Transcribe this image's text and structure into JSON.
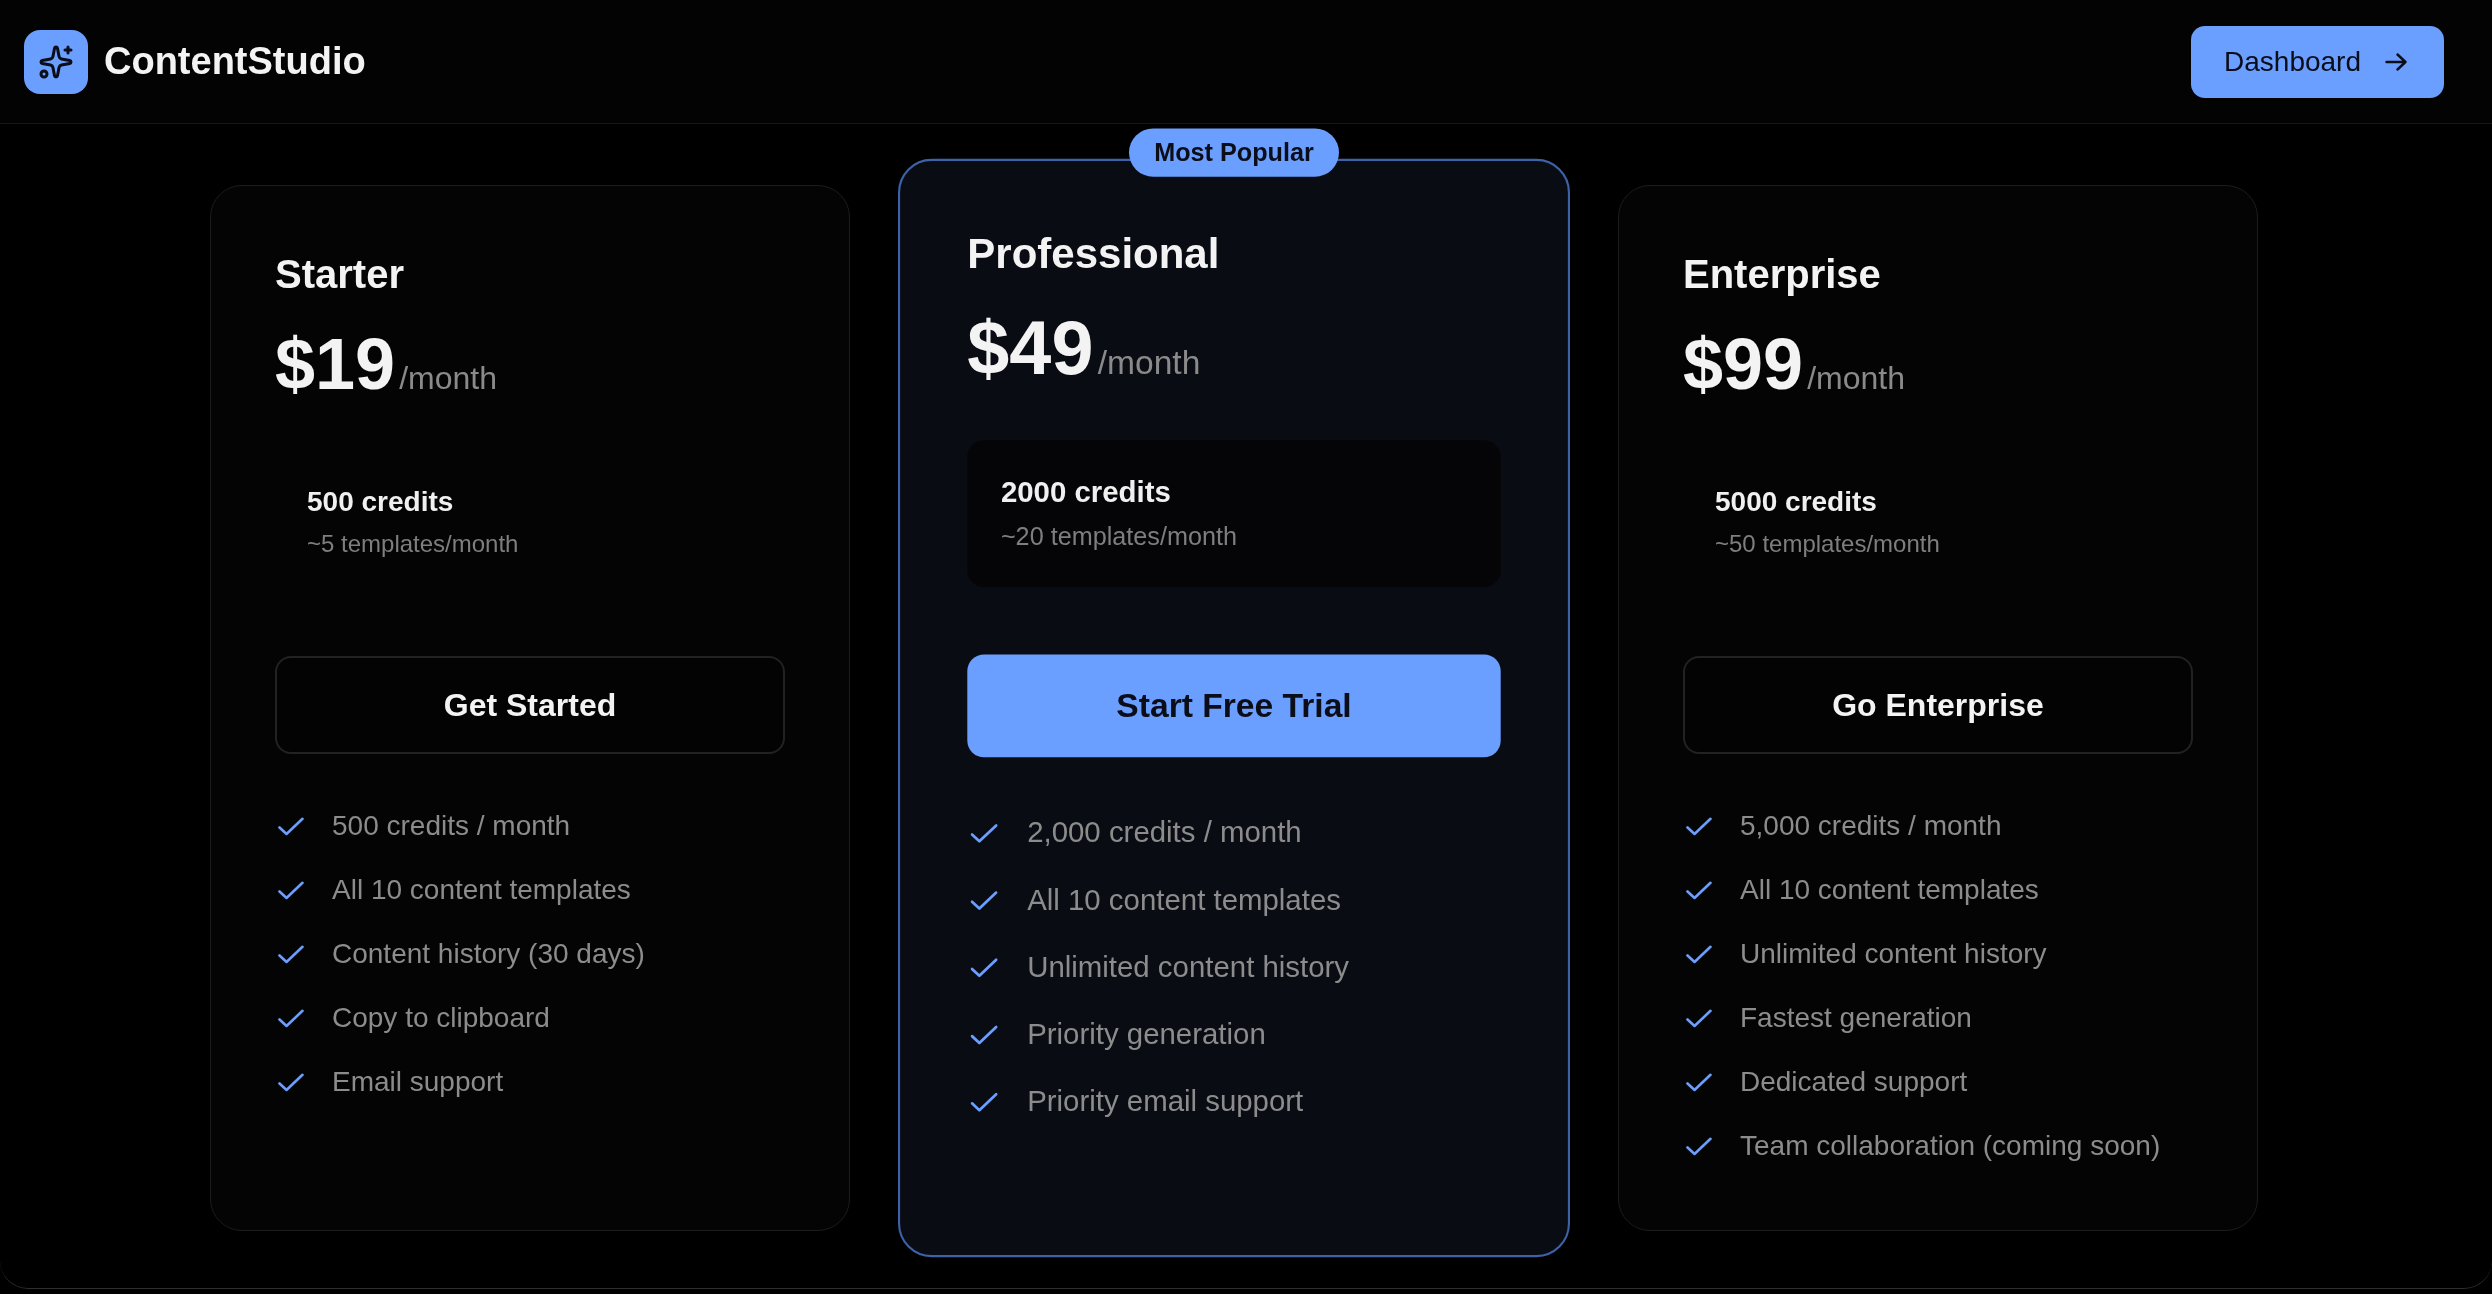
{
  "header": {
    "brand": "ContentStudio",
    "dashboard_button": "Dashboard"
  },
  "plans": [
    {
      "name": "Starter",
      "featured": false,
      "price": "$19",
      "period": "/month",
      "credits": "500 credits",
      "credits_note": "~5 templates/month",
      "button": "Get Started",
      "features": [
        "500 credits / month",
        "All 10 content templates",
        "Content history (30 days)",
        "Copy to clipboard",
        "Email support"
      ]
    },
    {
      "name": "Professional",
      "featured": true,
      "badge": "Most Popular",
      "price": "$49",
      "period": "/month",
      "credits": "2000 credits",
      "credits_note": "~20 templates/month",
      "button": "Start Free Trial",
      "features": [
        "2,000 credits / month",
        "All 10 content templates",
        "Unlimited content history",
        "Priority generation",
        "Priority email support"
      ]
    },
    {
      "name": "Enterprise",
      "featured": false,
      "price": "$99",
      "period": "/month",
      "credits": "5000 credits",
      "credits_note": "~50 templates/month",
      "button": "Go Enterprise",
      "features": [
        "5,000 credits / month",
        "All 10 content templates",
        "Unlimited content history",
        "Fastest generation",
        "Dedicated support",
        "Team collaboration (coming soon)"
      ]
    }
  ]
}
